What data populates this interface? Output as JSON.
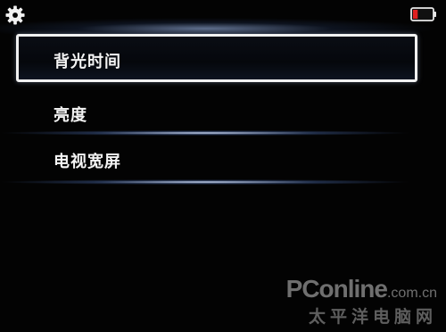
{
  "status_bar": {
    "settings_icon": "gear-icon",
    "battery_icon": "battery-low-icon",
    "battery_level_fraction": 0.25,
    "battery_color": "#e02020"
  },
  "menu": {
    "items": [
      {
        "label": "背光时间",
        "selected": true
      },
      {
        "label": "亮度",
        "selected": false
      },
      {
        "label": "电视宽屏",
        "selected": false
      }
    ]
  },
  "watermark": {
    "main": "PConline",
    "suffix": ".com.cn",
    "sub": "太平洋电脑网"
  },
  "colors": {
    "background": "#030303",
    "text": "#f4f4f4",
    "divider_glow": "#d2e1ff"
  }
}
